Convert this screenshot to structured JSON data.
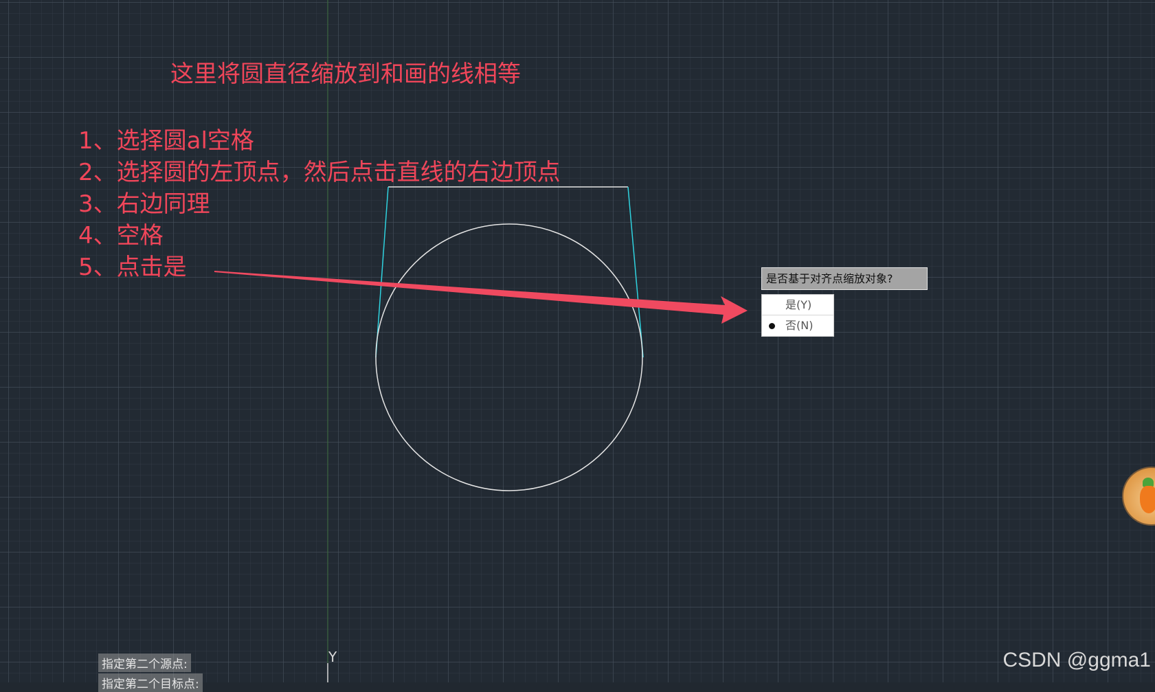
{
  "annotation": {
    "title": "这里将圆直径缩放到和画的线相等",
    "steps": [
      "1、选择圆al空格",
      "2、选择圆的左顶点，然后点击直线的右边顶点",
      "3、右边同理",
      "4、空格",
      "5、点击是"
    ],
    "color": "#f0465a"
  },
  "prompt": {
    "question": "是否基于对齐点缩放对象?",
    "options": [
      {
        "label": "是(Y)",
        "selected": false
      },
      {
        "label": "否(N)",
        "selected": true
      }
    ]
  },
  "command_history": [
    "指定第二个源点:",
    "指定第二个目标点:"
  ],
  "ucs": {
    "y_label": "Y"
  },
  "watermark": "CSDN @ggma1",
  "colors": {
    "background": "#222a33",
    "circle": "#e6e6e6",
    "cyan_lines": "#2fd3e0",
    "trapezoid_top": "#e6e6e6",
    "arrow": "#f04a60",
    "y_axis": "#3c6e3c"
  },
  "icons": {
    "avatar": "carrot-avatar-icon",
    "arrow": "pointer-arrow-annotation"
  }
}
